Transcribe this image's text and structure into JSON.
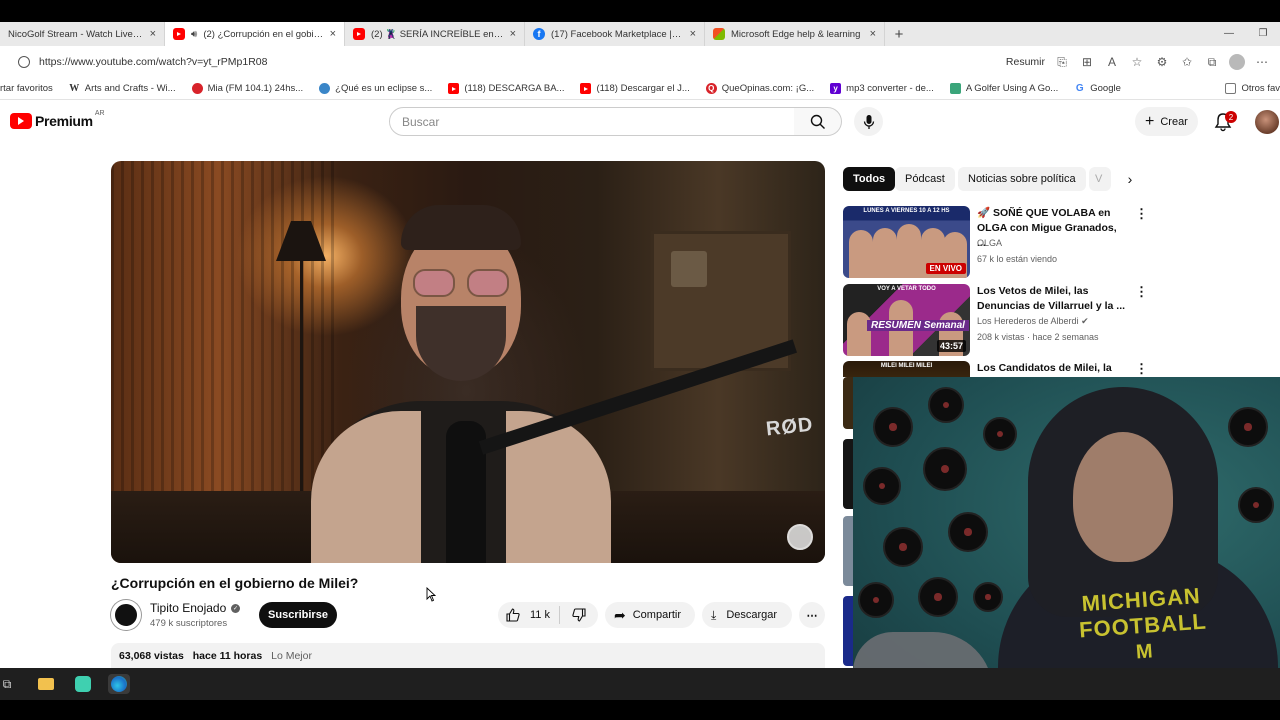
{
  "browser": {
    "tabs": [
      {
        "label": "NicoGolf Stream - Watch Live on",
        "icon": "page-icon",
        "active": false
      },
      {
        "label": "(2) ¿Corrupción en el gobierno",
        "icon": "youtube-icon",
        "active": true
      },
      {
        "label": "(2) 🦹 SERÍA INCREÍBLE en OLGA",
        "icon": "youtube-icon",
        "active": false
      },
      {
        "label": "(17) Facebook Marketplace | Face",
        "icon": "facebook-icon",
        "active": false
      },
      {
        "label": "Microsoft Edge help & learning",
        "icon": "microsoft-icon",
        "active": false
      }
    ],
    "close_glyph": "×",
    "new_tab_glyph": "+",
    "url": "https://www.youtube.com/watch?v=yt_rPMp1R08",
    "resumir_label": "Resumir",
    "favorites": [
      {
        "label": "rtar favoritos",
        "icon": "none",
        "color": ""
      },
      {
        "label": "Arts and Crafts - Wi...",
        "icon": "wikipedia-icon",
        "color": "#333333"
      },
      {
        "label": "Mia (FM 104.1) 24hs...",
        "icon": "radio-icon",
        "color": "#d8232a"
      },
      {
        "label": "¿Qué es un eclipse s...",
        "icon": "eclipse-icon",
        "color": "#3a86c8"
      },
      {
        "label": "(118) DESCARGA BA...",
        "icon": "youtube-icon",
        "color": "#ff0000"
      },
      {
        "label": "(118) Descargar el J...",
        "icon": "youtube-icon",
        "color": "#ff0000"
      },
      {
        "label": "QueOpinas.com: ¡G...",
        "icon": "queopinas-icon",
        "color": "#d8232a"
      },
      {
        "label": "mp3 converter - de...",
        "icon": "yahoo-icon",
        "color": "#6001d2"
      },
      {
        "label": "A Golfer Using A Go...",
        "icon": "page-icon",
        "color": "#3aa57a"
      },
      {
        "label": "Google",
        "icon": "google-icon",
        "color": "#4285f4"
      }
    ],
    "other_favorites": "Otros fav"
  },
  "youtube": {
    "logo_text": "Premium",
    "logo_country": "AR",
    "search_placeholder": "Buscar",
    "create_label": "Crear",
    "notification_count": "2",
    "video": {
      "title": "¿Corrupción en el gobierno de Milei?",
      "channel": "Tipito Enojado",
      "subscribers": "479 k suscriptores",
      "subscribe_label": "Suscribirse",
      "likes": "11 k",
      "share_label": "Compartir",
      "download_label": "Descargar",
      "views": "63,068 vistas",
      "age": "hace 11 horas",
      "tag": "Lo Mejor",
      "brand_text": "RØD"
    },
    "chips": [
      "Todos",
      "Pódcast",
      "Noticias sobre política",
      "V"
    ],
    "recommendations": [
      {
        "title": "🚀 SOÑÉ QUE VOLABA en OLGA con Migue Granados, ...",
        "channel": "OLGA",
        "meta": "67 k lo están viendo",
        "badge": "EN VIVO",
        "badge_type": "live",
        "thumb_caption": "LUNES A VIERNES 10 A 12 HS"
      },
      {
        "title": "Los Vetos de Milei, las Denuncias de Villarruel y la ...",
        "channel": "Los Herederos de Alberdi",
        "meta": "208 k vistas · hace 2 semanas",
        "badge": "43:57",
        "badge_type": "duration",
        "thumb_caption": "VOY A VETAR TODO",
        "thumb_overlay": "RESUMEN Semanal"
      },
      {
        "title": "Los Candidatos de Milei, la",
        "channel": "",
        "meta": "",
        "badge": "",
        "badge_type": "none",
        "thumb_caption": "MILEI MILEI MILEI"
      }
    ]
  },
  "webcam": {
    "shirt_text_line1": "MICHIGAN",
    "shirt_text_line2": "FOOTBALL",
    "shirt_logo": "M"
  },
  "colors": {
    "youtube_red": "#ff0000",
    "subscribe_bg": "#0f0f0f",
    "chip_bg": "#f2f2f2",
    "michigan_maize": "#c8c230"
  }
}
